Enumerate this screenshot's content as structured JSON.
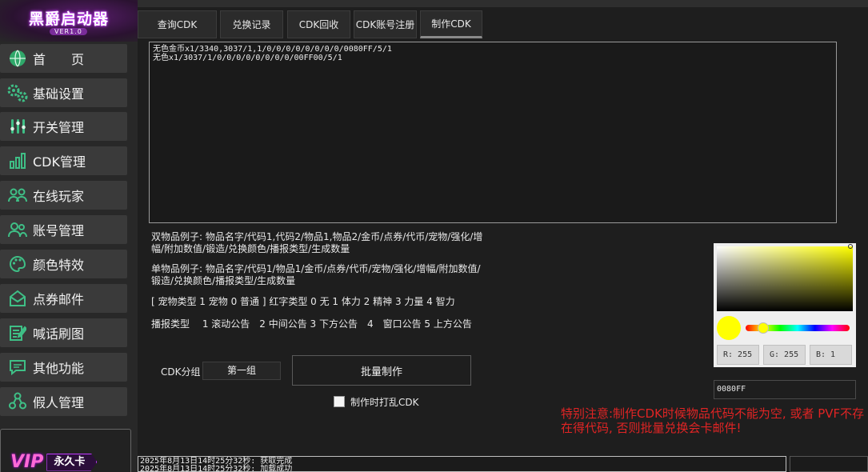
{
  "app": {
    "logo_title": "黑爵启动器",
    "logo_version": "VER1.0"
  },
  "sidebar": {
    "items": [
      {
        "label": "首　　页",
        "icon": "globe-icon"
      },
      {
        "label": "基础设置",
        "icon": "gears-icon"
      },
      {
        "label": "开关管理",
        "icon": "switches-icon"
      },
      {
        "label": "CDK管理",
        "icon": "bar-chart-icon"
      },
      {
        "label": "在线玩家",
        "icon": "users-icon"
      },
      {
        "label": "账号管理",
        "icon": "account-icon"
      },
      {
        "label": "颜色特效",
        "icon": "palette-icon"
      },
      {
        "label": "点券邮件",
        "icon": "mail-icon"
      },
      {
        "label": "喊话刷图",
        "icon": "edit-icon"
      },
      {
        "label": "其他功能",
        "icon": "chat-icon"
      },
      {
        "label": "假人管理",
        "icon": "bot-icon"
      }
    ],
    "vip": {
      "badge": "VIP",
      "label": "永久卡"
    }
  },
  "tabs": [
    {
      "label": "查询CDK"
    },
    {
      "label": "兑换记录"
    },
    {
      "label": "CDK回收"
    },
    {
      "label": "CDK账号注册"
    },
    {
      "label": "制作CDK",
      "active": true
    }
  ],
  "editor": {
    "lines": "无色金币x1/3340,3037/1,1/0/0/0/0/0/0/0/0/0080FF/5/1\n无色x1/3037/1/0/0/0/0/0/0/0/0/00FF00/5/1"
  },
  "notes": {
    "double_item": "双物品例子: 物品名字/代码1,代码2/物品1,物品2/金币/点券/代币/宠物/强化/增幅/附加数值/锻造/兑换颜色/播报类型/生成数量",
    "single_item": "单物品例子: 物品名字/代码1/物品1/金币/点券/代币/宠物/强化/增幅/附加数值/锻造/兑换颜色/播报类型/生成数量",
    "pet_types": "[ 宠物类型 1 宠物 0 普通 ] 红字类型 0 无 1 体力 2 精神 3 力量 4 智力",
    "broadcast_types": "播报类型　 1 滚动公告　2 中间公告 3 下方公告　4　窗口公告 5 上方公告"
  },
  "form": {
    "group_label": "CDK分组",
    "group_value": "第一组",
    "batch_button": "批量制作",
    "shuffle_label": "制作时打乱CDK",
    "shuffle_checked": false
  },
  "warning": "特别注意:制作CDK时候物品代码不能为空, 或者 PVF不存\n在得代码, 否则批量兑换会卡邮件!",
  "color_picker": {
    "selected_color": "#FFFF01",
    "hue_fraction": 0.17,
    "r_label": "R: 255",
    "g_label": "G: 255",
    "b_label": "B: 1",
    "hex_value": "0080FF"
  },
  "log": {
    "lines": "2025年8月13日14时25分32秒: 获取完成\n2025年8月13日14时25分32秒: 加载成功"
  }
}
